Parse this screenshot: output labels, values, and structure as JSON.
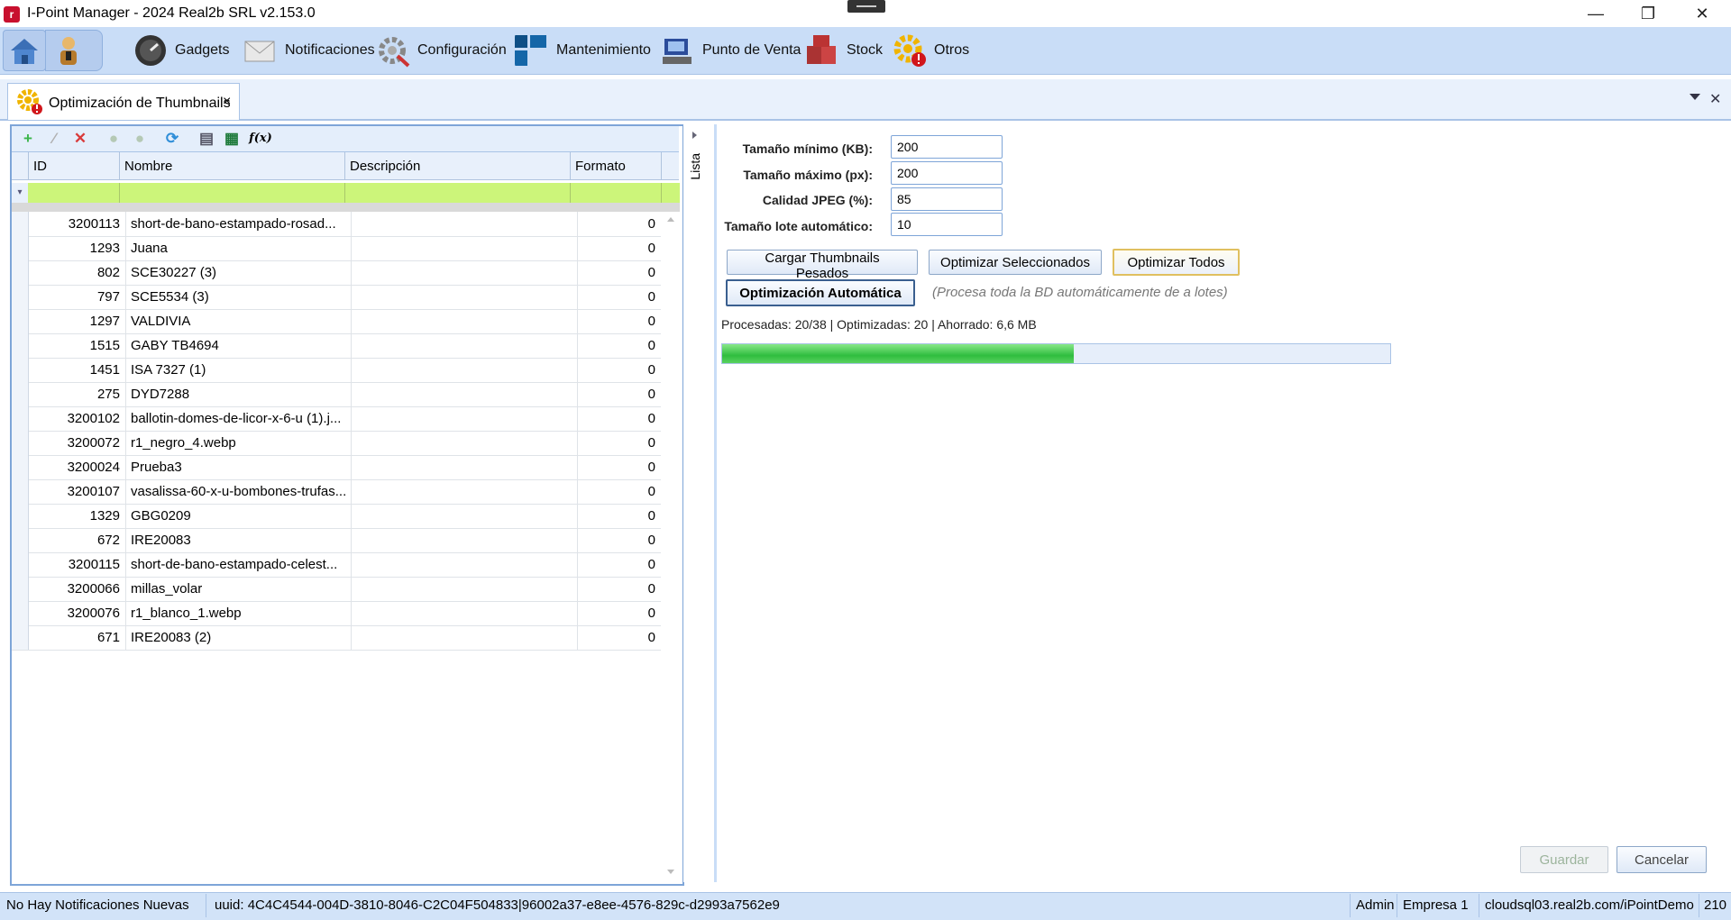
{
  "window": {
    "title": "I-Point Manager - 2024 Real2b SRL v2.153.0",
    "logo_text": "r",
    "controls": {
      "minimize": "—",
      "restore": "❐",
      "close": "✕"
    }
  },
  "ribbon": {
    "items": [
      {
        "label": "Gadgets",
        "icon": "gauge-icon"
      },
      {
        "label": "Notificaciones",
        "icon": "envelope-icon"
      },
      {
        "label": "Configuración",
        "icon": "gear-tools-icon"
      },
      {
        "label": "Mantenimiento",
        "icon": "blocks-icon"
      },
      {
        "label": "Punto de Venta",
        "icon": "pos-terminal-icon"
      },
      {
        "label": "Stock",
        "icon": "boxes-icon"
      },
      {
        "label": "Otros",
        "icon": "gear-alert-icon"
      }
    ]
  },
  "tab": {
    "label": "Optimización de Thumbnails",
    "close": "×"
  },
  "grid": {
    "columns": [
      "ID",
      "Nombre",
      "Descripción",
      "Formato"
    ],
    "rows": [
      {
        "id": "3200113",
        "nombre": "short-de-bano-estampado-rosad...",
        "descripcion": "",
        "formato": "0"
      },
      {
        "id": "1293",
        "nombre": "Juana",
        "descripcion": "",
        "formato": "0"
      },
      {
        "id": "802",
        "nombre": "SCE30227 (3)",
        "descripcion": "",
        "formato": "0"
      },
      {
        "id": "797",
        "nombre": "SCE5534 (3)",
        "descripcion": "",
        "formato": "0"
      },
      {
        "id": "1297",
        "nombre": "VALDIVIA",
        "descripcion": "",
        "formato": "0"
      },
      {
        "id": "1515",
        "nombre": "GABY TB4694",
        "descripcion": "",
        "formato": "0"
      },
      {
        "id": "1451",
        "nombre": "ISA 7327 (1)",
        "descripcion": "",
        "formato": "0"
      },
      {
        "id": "275",
        "nombre": "DYD7288",
        "descripcion": "",
        "formato": "0"
      },
      {
        "id": "3200102",
        "nombre": "ballotin-domes-de-licor-x-6-u (1).j...",
        "descripcion": "",
        "formato": "0"
      },
      {
        "id": "3200072",
        "nombre": "r1_negro_4.webp",
        "descripcion": "",
        "formato": "0"
      },
      {
        "id": "3200024",
        "nombre": "Prueba3",
        "descripcion": "",
        "formato": "0"
      },
      {
        "id": "3200107",
        "nombre": "vasalissa-60-x-u-bombones-trufas...",
        "descripcion": "",
        "formato": "0"
      },
      {
        "id": "1329",
        "nombre": "GBG0209",
        "descripcion": "",
        "formato": "0"
      },
      {
        "id": "672",
        "nombre": "IRE20083",
        "descripcion": "",
        "formato": "0"
      },
      {
        "id": "3200115",
        "nombre": "short-de-bano-estampado-celest...",
        "descripcion": "",
        "formato": "0"
      },
      {
        "id": "3200066",
        "nombre": "millas_volar",
        "descripcion": "",
        "formato": "0"
      },
      {
        "id": "3200076",
        "nombre": "r1_blanco_1.webp",
        "descripcion": "",
        "formato": "0"
      },
      {
        "id": "671",
        "nombre": "IRE20083 (2)",
        "descripcion": "",
        "formato": "0"
      }
    ]
  },
  "splitter": {
    "label": "Lista"
  },
  "form": {
    "tamano_minimo": {
      "label": "Tamaño mínimo (KB):",
      "value": "200"
    },
    "tamano_maximo": {
      "label": "Tamaño máximo (px):",
      "value": "200"
    },
    "calidad_jpeg": {
      "label": "Calidad JPEG (%):",
      "value": "85"
    },
    "tamano_lote": {
      "label": "Tamaño lote automático:",
      "value": "10"
    },
    "buttons": {
      "cargar": "Cargar Thumbnails Pesados",
      "optimizar_seleccionados": "Optimizar Seleccionados",
      "optimizar_todos": "Optimizar Todos",
      "auto": "Optimización Automática"
    },
    "auto_note": "(Procesa toda la BD automáticamente de a lotes)",
    "status": "Procesadas: 20/38 | Optimizadas: 20 | Ahorrado: 6,6 MB",
    "progress_fraction": 0.526,
    "guardar": "Guardar",
    "cancelar": "Cancelar"
  },
  "statusbar": {
    "notifications": "No Hay Notificaciones Nuevas",
    "uuid": "uuid: 4C4C4544-004D-3810-8046-C2C04F504833|96002a37-e8ee-4576-829c-d2993a7562e9",
    "user": "Admin",
    "company": "Empresa 1",
    "server": "cloudsql03.real2b.com/iPointDemo",
    "extra": "210"
  },
  "colors": {
    "ribbon": "#c9ddf7",
    "filter_row": "#ccf57a",
    "progress": "#2fbd3f",
    "accent_border": "#7ea5d8"
  }
}
